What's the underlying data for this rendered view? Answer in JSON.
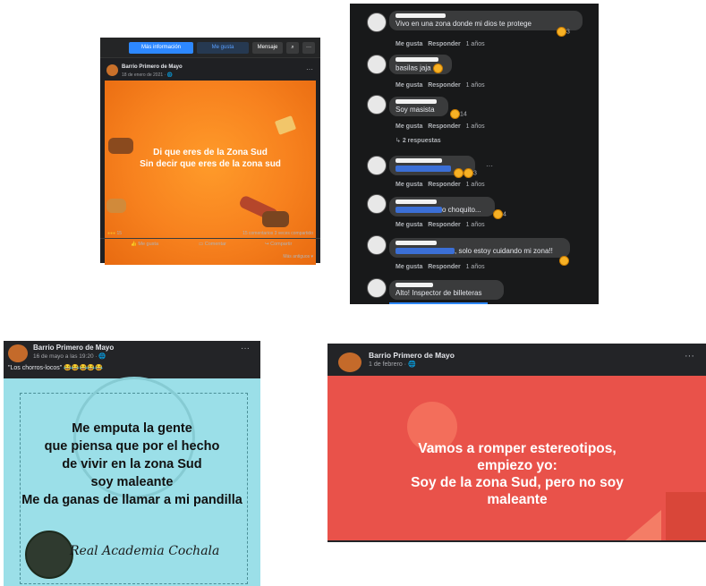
{
  "panel1": {
    "topbar": {
      "info_btn": "Más información",
      "like_btn": "Me gusta",
      "msg_btn": "Mensaje"
    },
    "page_name": "Barrio Primero de Mayo",
    "date": "18 de enero de 2021 · 🌐",
    "image_text_line1": "Di que eres de la Zona Sud",
    "image_text_line2": "Sin decir que eres de la zona sud",
    "stats_left": "15",
    "stats_right": "15 comentarios  3 veces compartido",
    "actions": {
      "like": "Me gusta",
      "comment": "Comentar",
      "share": "Compartir"
    },
    "sort": "Más antiguos ▾",
    "colors": {
      "image_bg": "#f7811e"
    }
  },
  "panel2": {
    "comments": [
      {
        "text": "Vivo en una zona donde mi dios te protege",
        "reactions": "3",
        "like": "Me gusta",
        "reply": "Responder",
        "time": "1 años"
      },
      {
        "text": "basilas jaja",
        "reactions": "",
        "like": "Me gusta",
        "reply": "Responder",
        "time": "1 años"
      },
      {
        "text": "Soy masista",
        "reactions": "14",
        "like": "Me gusta",
        "reply": "Responder",
        "time": "1 años",
        "replies": "2 respuestas"
      },
      {
        "text": "",
        "reactions": "3",
        "like": "Me gusta",
        "reply": "Responder",
        "time": "1 años"
      },
      {
        "text": "o choquito...",
        "reactions": "4",
        "like": "Me gusta",
        "reply": "Responder",
        "time": "1 años"
      },
      {
        "text": ", solo estoy cuidando mi zona!!",
        "reactions": "",
        "like": "Me gusta",
        "reply": "Responder",
        "time": "1 años"
      },
      {
        "text": "Alto! Inspector de billeteras",
        "reactions": "",
        "like": "",
        "reply": "",
        "time": ""
      }
    ]
  },
  "panel3": {
    "page_name": "Barrio Primero de Mayo",
    "date": "16 de mayo a las 19:20 · 🌐",
    "caption": "\"Los chorros-locos\" 😂😂😂😂😂",
    "meme_lines": [
      "Me emputa la gente",
      "que piensa que por el hecho",
      "de vivir en la zona Sud",
      "soy maleante",
      "Me da ganas de llamar a mi pandilla"
    ],
    "signature": "Real Academia Cochala",
    "colors": {
      "image_bg": "#9bdfe8"
    }
  },
  "panel4": {
    "page_name": "Barrio Primero de Mayo",
    "date": "1 de febrero · 🌐",
    "meme_lines": [
      "Vamos a romper estereotipos,",
      "empiezo yo:",
      "Soy de la zona Sud, pero no soy",
      "maleante"
    ],
    "colors": {
      "image_bg": "#e9524a"
    }
  }
}
